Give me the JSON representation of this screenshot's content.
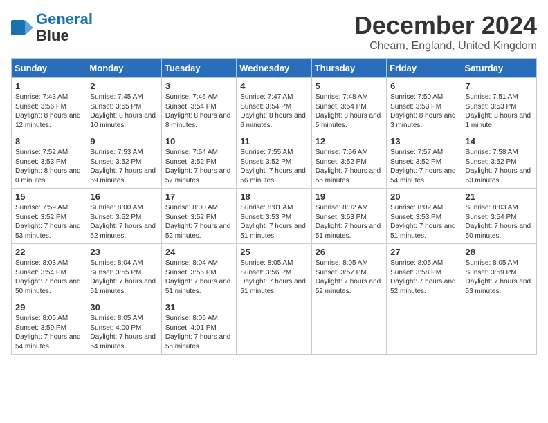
{
  "header": {
    "logo_line1": "General",
    "logo_line2": "Blue",
    "month_title": "December 2024",
    "location": "Cheam, England, United Kingdom"
  },
  "days_of_week": [
    "Sunday",
    "Monday",
    "Tuesday",
    "Wednesday",
    "Thursday",
    "Friday",
    "Saturday"
  ],
  "weeks": [
    [
      {
        "num": "1",
        "rise": "7:43 AM",
        "set": "3:56 PM",
        "daylight": "8 hours and 12 minutes."
      },
      {
        "num": "2",
        "rise": "7:45 AM",
        "set": "3:55 PM",
        "daylight": "8 hours and 10 minutes."
      },
      {
        "num": "3",
        "rise": "7:46 AM",
        "set": "3:54 PM",
        "daylight": "8 hours and 8 minutes."
      },
      {
        "num": "4",
        "rise": "7:47 AM",
        "set": "3:54 PM",
        "daylight": "8 hours and 6 minutes."
      },
      {
        "num": "5",
        "rise": "7:48 AM",
        "set": "3:54 PM",
        "daylight": "8 hours and 5 minutes."
      },
      {
        "num": "6",
        "rise": "7:50 AM",
        "set": "3:53 PM",
        "daylight": "8 hours and 3 minutes."
      },
      {
        "num": "7",
        "rise": "7:51 AM",
        "set": "3:53 PM",
        "daylight": "8 hours and 1 minute."
      }
    ],
    [
      {
        "num": "8",
        "rise": "7:52 AM",
        "set": "3:53 PM",
        "daylight": "8 hours and 0 minutes."
      },
      {
        "num": "9",
        "rise": "7:53 AM",
        "set": "3:52 PM",
        "daylight": "7 hours and 59 minutes."
      },
      {
        "num": "10",
        "rise": "7:54 AM",
        "set": "3:52 PM",
        "daylight": "7 hours and 57 minutes."
      },
      {
        "num": "11",
        "rise": "7:55 AM",
        "set": "3:52 PM",
        "daylight": "7 hours and 56 minutes."
      },
      {
        "num": "12",
        "rise": "7:56 AM",
        "set": "3:52 PM",
        "daylight": "7 hours and 55 minutes."
      },
      {
        "num": "13",
        "rise": "7:57 AM",
        "set": "3:52 PM",
        "daylight": "7 hours and 54 minutes."
      },
      {
        "num": "14",
        "rise": "7:58 AM",
        "set": "3:52 PM",
        "daylight": "7 hours and 53 minutes."
      }
    ],
    [
      {
        "num": "15",
        "rise": "7:59 AM",
        "set": "3:52 PM",
        "daylight": "7 hours and 53 minutes."
      },
      {
        "num": "16",
        "rise": "8:00 AM",
        "set": "3:52 PM",
        "daylight": "7 hours and 52 minutes."
      },
      {
        "num": "17",
        "rise": "8:00 AM",
        "set": "3:52 PM",
        "daylight": "7 hours and 52 minutes."
      },
      {
        "num": "18",
        "rise": "8:01 AM",
        "set": "3:53 PM",
        "daylight": "7 hours and 51 minutes."
      },
      {
        "num": "19",
        "rise": "8:02 AM",
        "set": "3:53 PM",
        "daylight": "7 hours and 51 minutes."
      },
      {
        "num": "20",
        "rise": "8:02 AM",
        "set": "3:53 PM",
        "daylight": "7 hours and 51 minutes."
      },
      {
        "num": "21",
        "rise": "8:03 AM",
        "set": "3:54 PM",
        "daylight": "7 hours and 50 minutes."
      }
    ],
    [
      {
        "num": "22",
        "rise": "8:03 AM",
        "set": "3:54 PM",
        "daylight": "7 hours and 50 minutes."
      },
      {
        "num": "23",
        "rise": "8:04 AM",
        "set": "3:55 PM",
        "daylight": "7 hours and 51 minutes."
      },
      {
        "num": "24",
        "rise": "8:04 AM",
        "set": "3:56 PM",
        "daylight": "7 hours and 51 minutes."
      },
      {
        "num": "25",
        "rise": "8:05 AM",
        "set": "3:56 PM",
        "daylight": "7 hours and 51 minutes."
      },
      {
        "num": "26",
        "rise": "8:05 AM",
        "set": "3:57 PM",
        "daylight": "7 hours and 52 minutes."
      },
      {
        "num": "27",
        "rise": "8:05 AM",
        "set": "3:58 PM",
        "daylight": "7 hours and 52 minutes."
      },
      {
        "num": "28",
        "rise": "8:05 AM",
        "set": "3:59 PM",
        "daylight": "7 hours and 53 minutes."
      }
    ],
    [
      {
        "num": "29",
        "rise": "8:05 AM",
        "set": "3:59 PM",
        "daylight": "7 hours and 54 minutes."
      },
      {
        "num": "30",
        "rise": "8:05 AM",
        "set": "4:00 PM",
        "daylight": "7 hours and 54 minutes."
      },
      {
        "num": "31",
        "rise": "8:05 AM",
        "set": "4:01 PM",
        "daylight": "7 hours and 55 minutes."
      },
      null,
      null,
      null,
      null
    ]
  ]
}
